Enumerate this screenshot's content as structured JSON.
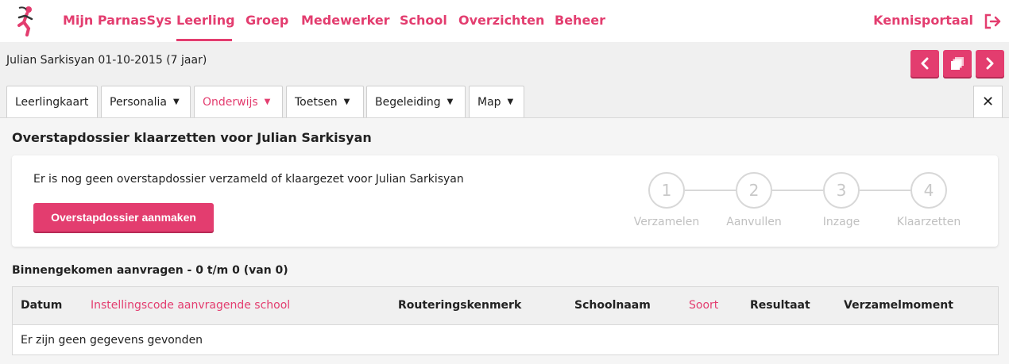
{
  "nav": {
    "items": [
      "Mijn ParnasSys",
      "Leerling",
      "Groep",
      "Medewerker",
      "School",
      "Overzichten",
      "Beheer"
    ],
    "active": "Leerling",
    "kennisportaal": "Kennisportaal",
    "logout_icon": "logout-icon",
    "logo_icon": "parnassys-runner-logo"
  },
  "student": {
    "header": "Julian Sarkisyan 01-10-2015 (7 jaar)"
  },
  "pager": {
    "prev_icon": "chevron-left-icon",
    "list_icon": "stack-icon",
    "next_icon": "chevron-right-icon"
  },
  "tabs": [
    {
      "label": "Leerlingkaart",
      "dropdown": false
    },
    {
      "label": "Personalia",
      "dropdown": true
    },
    {
      "label": "Onderwijs",
      "dropdown": true,
      "active": true
    },
    {
      "label": "Toetsen",
      "dropdown": true
    },
    {
      "label": "Begeleiding",
      "dropdown": true
    },
    {
      "label": "Map",
      "dropdown": true
    }
  ],
  "caret": "▼",
  "close_symbol": "✕",
  "page": {
    "title": "Overstapdossier klaarzetten voor Julian Sarkisyan"
  },
  "card": {
    "message": "Er is nog geen overstapdossier verzameld of klaargezet voor Julian Sarkisyan",
    "button_label": "Overstapdossier aanmaken"
  },
  "steps": [
    {
      "number": "1",
      "label": "Verzamelen"
    },
    {
      "number": "2",
      "label": "Aanvullen"
    },
    {
      "number": "3",
      "label": "Inzage"
    },
    {
      "number": "4",
      "label": "Klaarzetten"
    }
  ],
  "requests": {
    "title": "Binnengekomen aanvragen - 0 t/m 0 (van 0)",
    "columns": [
      {
        "label": "Datum",
        "sortable": false
      },
      {
        "label": "Instellingscode aanvragende school",
        "sortable": true
      },
      {
        "label": "Routeringskenmerk",
        "sortable": false
      },
      {
        "label": "Schoolnaam",
        "sortable": false
      },
      {
        "label": "Soort",
        "sortable": true
      },
      {
        "label": "Resultaat",
        "sortable": false
      },
      {
        "label": "Verzamelmoment",
        "sortable": false
      }
    ],
    "empty_message": "Er zijn geen gegevens gevonden"
  },
  "colors": {
    "accent": "#e33d6f",
    "muted": "#c8c8c8"
  }
}
